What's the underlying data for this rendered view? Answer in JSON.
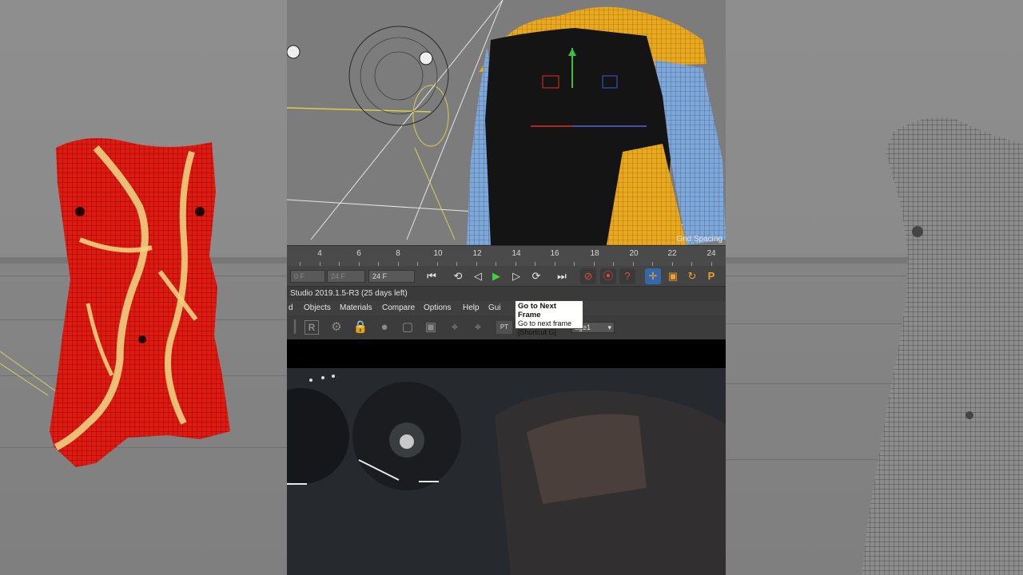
{
  "viewport": {
    "grid_label": "Grid Spacing"
  },
  "timeline": {
    "ruler_labels": [
      "4",
      "6",
      "8",
      "10",
      "12",
      "14",
      "16",
      "18",
      "20",
      "22",
      "24"
    ],
    "start_field": "0 F",
    "mid_field": "24 F",
    "end_field": "24 F"
  },
  "transport": {
    "buttons": [
      "go-to-start",
      "previous-key",
      "previous-frame",
      "play",
      "next-frame",
      "next-key",
      "go-to-end"
    ],
    "record_buttons": [
      "record-active",
      "autokey",
      "keyframe-selection"
    ],
    "key_buttons": [
      "position-key",
      "scale-key",
      "rotation-key",
      "parameter-key"
    ]
  },
  "window": {
    "title": "Studio 2019.1.5-R3 (25 days left)"
  },
  "menu": {
    "items": [
      "d",
      "Objects",
      "Materials",
      "Compare",
      "Options",
      "Help",
      "Gui"
    ]
  },
  "toolbar": {
    "pt_label": "PT",
    "layer_value": "age1"
  },
  "tooltip": {
    "title": "Go to Next Frame",
    "description": "Go to next frame",
    "shortcut": "[Shortcut G]"
  },
  "colors": {
    "mesh_red": "#e01a10",
    "mesh_yellow_stripe": "#f0d080",
    "body_yellow": "#e8a820",
    "body_blue": "#7fa7d8",
    "ui_dark": "#3c3c3c"
  }
}
